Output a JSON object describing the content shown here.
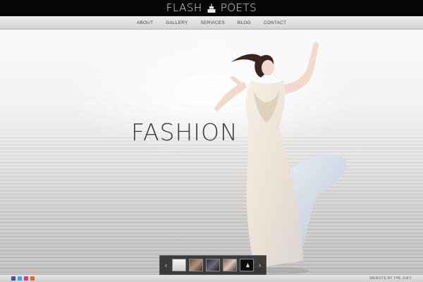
{
  "brand": {
    "left_word": "FLASH",
    "right_word": "POETS",
    "logo_icon": "cake-icon"
  },
  "nav": {
    "items": [
      {
        "label": "About"
      },
      {
        "label": "Gallery"
      },
      {
        "label": "Services"
      },
      {
        "label": "Blog"
      },
      {
        "label": "Contact"
      }
    ]
  },
  "hero": {
    "title": "FASHION"
  },
  "slider": {
    "prev_icon": "chevron-left-icon",
    "next_icon": "chevron-right-icon",
    "prev_glyph": "‹",
    "next_glyph": "›",
    "thumbnail_count": 5
  },
  "footer": {
    "socials": [
      {
        "name": "facebook-icon",
        "color": "#3b5998"
      },
      {
        "name": "twitter-icon",
        "color": "#33aaee"
      },
      {
        "name": "flickr-icon",
        "color": "#d63a78"
      },
      {
        "name": "rss-icon",
        "color": "#e4632a"
      }
    ],
    "credit": "WEBSITE BY THE JUKY"
  },
  "colors": {
    "topbar": "#050505",
    "navbar": "#dcdcdc",
    "title_text": "#3b3b3b"
  }
}
